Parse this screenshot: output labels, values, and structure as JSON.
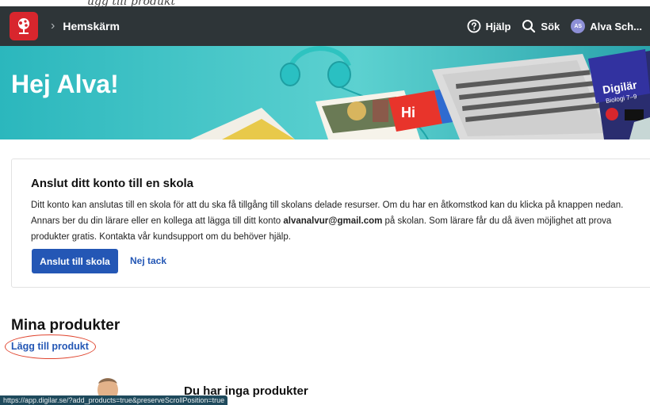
{
  "header": {
    "breadcrumb": "Hemskärm",
    "help_label": "Hjälp",
    "search_label": "Sök",
    "avatar_initials": "AS",
    "user_name": "Alva Sch..."
  },
  "hero": {
    "greeting": "Hej Alva!",
    "book_badge": "Hi",
    "product_logo": "Digilär",
    "product_subtitle": "Biologi 7–9"
  },
  "connect_card": {
    "title": "Anslut ditt konto till en skola",
    "text_before_email": "Ditt konto kan anslutas till en skola för att du ska få tillgång till skolans delade resurser. Om du har en åtkomstkod kan du klicka på knappen nedan. Annars ber du din lärare eller en kollega att lägga till ditt konto ",
    "email": "alvanalvur@gmail.com",
    "text_after_email": " på skolan. Som lärare får du då även möjlighet att prova produkter gratis. Kontakta vår kundsupport om du behöver hjälp.",
    "primary_button": "Anslut till skola",
    "secondary_button": "Nej tack"
  },
  "products": {
    "title": "Mina produkter",
    "add_link": "Lägg till produkt",
    "empty_title": "Du har inga produkter"
  },
  "status_url": "https://app.digilar.se/?add_products=true&preserveScrollPosition=true",
  "colors": {
    "header_bg": "#2e3538",
    "logo_red": "#d8262d",
    "accent_blue": "#2457b5",
    "hero_teal": "#3cc3c6",
    "annotation_red": "#e0452f"
  }
}
